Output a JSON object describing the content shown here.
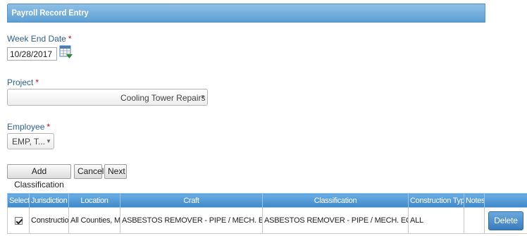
{
  "panel": {
    "title": "Payroll Record Entry"
  },
  "week_end": {
    "label": "Week End Date",
    "required_mark": "*",
    "value": "10/28/2017"
  },
  "project": {
    "label": "Project",
    "required_mark": "*",
    "selected": "Cooling Tower Repairs"
  },
  "employee": {
    "label": "Employee",
    "required_mark": "*",
    "selected": "EMP, T..."
  },
  "buttons": {
    "add_classification": "Add Classification",
    "cancel": "Cancel",
    "next": "Next"
  },
  "grid": {
    "columns": [
      "Select",
      "Jurisdiction",
      "Location",
      "Craft",
      "Classification",
      "Construction Type",
      "Notes",
      ""
    ],
    "rows": [
      {
        "selected": true,
        "jurisdiction": "Construction",
        "location": "All Counties, MA",
        "craft": "ASBESTOS REMOVER - PIPE / MECH. EQUIPT",
        "classification": "ASBESTOS REMOVER - PIPE / MECH. EQUIPT",
        "construction_type": "ALL",
        "notes": "",
        "action": "Delete"
      }
    ]
  },
  "colors": {
    "header_blue": "#5d9fd4",
    "label_blue": "#2e5f96",
    "required_red": "#dd0000"
  },
  "icons": {
    "calendar": "calendar-icon",
    "dropdown": "chevron-down-icon"
  }
}
